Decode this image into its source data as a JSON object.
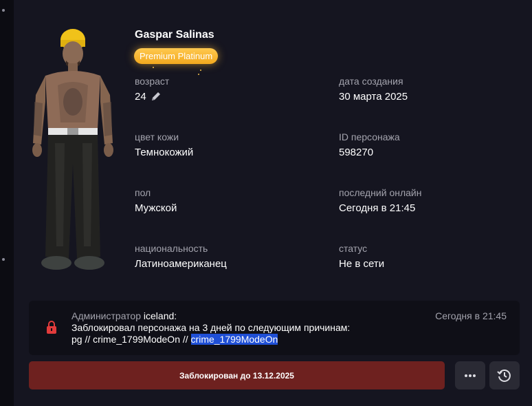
{
  "character": {
    "name": "Gaspar Salinas",
    "badge": "Premium Platinum"
  },
  "fields": {
    "age_label": "возраст",
    "age_value": "24",
    "created_label": "дата создания",
    "created_value": "30 марта 2025",
    "skin_label": "цвет кожи",
    "skin_value": "Темнокожий",
    "id_label": "ID персонажа",
    "id_value": "598270",
    "gender_label": "пол",
    "gender_value": "Мужской",
    "last_online_label": "последний онлайн",
    "last_online_value": "Сегодня в 21:45",
    "nationality_label": "национальность",
    "nationality_value": "Латиноамериканец",
    "status_label": "статус",
    "status_value": "Не в сети"
  },
  "notice": {
    "prefix": "Администратор",
    "admin": "iceland:",
    "time": "Сегодня в 21:45",
    "text_plain": "Заблокировал персонажа на 3 дней по следующим причинам: pg // crime_1799ModeOn // ",
    "text_selected": "crime_1799ModeOn"
  },
  "actions": {
    "blocked_label": "Заблокирован до 13.12.2025",
    "more_icon": "more-dots-icon",
    "history_icon": "history-clock-icon"
  },
  "colors": {
    "background": "#151520",
    "badge": "#f2a91f",
    "block_button": "#6e211f",
    "lock": "#e23b3b",
    "selection": "#1f4fd6"
  }
}
